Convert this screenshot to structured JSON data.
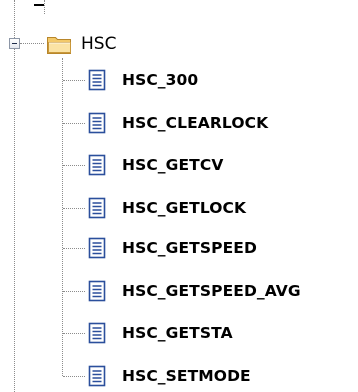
{
  "tree": {
    "folder": {
      "label": "HSC",
      "icon": "folder-open-icon",
      "expanded": true
    },
    "items": [
      {
        "label": "HSC_300",
        "icon": "document-icon"
      },
      {
        "label": "HSC_CLEARLOCK",
        "icon": "document-icon"
      },
      {
        "label": "HSC_GETCV",
        "icon": "document-icon"
      },
      {
        "label": "HSC_GETLOCK",
        "icon": "document-icon"
      },
      {
        "label": "HSC_GETSPEED",
        "icon": "document-icon"
      },
      {
        "label": "HSC_GETSPEED_AVG",
        "icon": "document-icon"
      },
      {
        "label": "HSC_GETSTA",
        "icon": "document-icon"
      },
      {
        "label": "HSC_SETMODE",
        "icon": "document-icon"
      }
    ]
  },
  "colors": {
    "guide_line": "#8c8c8c",
    "folder_fill": "#f7d98b",
    "folder_stroke": "#b8862b",
    "doc_stroke": "#2b4f9c"
  }
}
